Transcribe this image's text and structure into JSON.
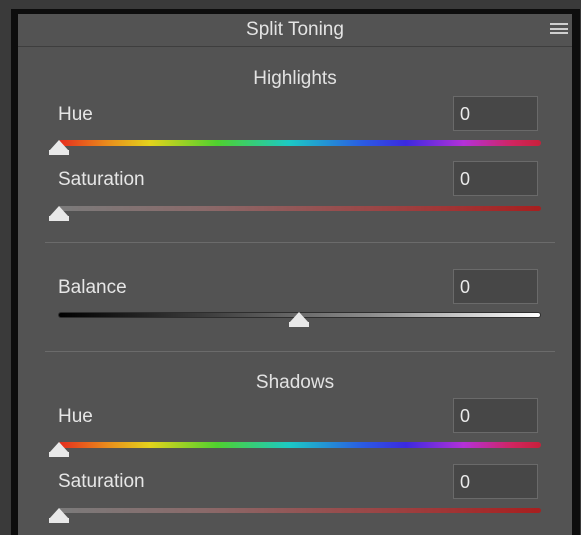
{
  "panel": {
    "title": "Split Toning",
    "menu_icon": "hamburger-menu-icon"
  },
  "highlights": {
    "heading": "Highlights",
    "hue": {
      "label": "Hue",
      "value": "0",
      "slider_fraction": 0.0
    },
    "saturation": {
      "label": "Saturation",
      "value": "0",
      "slider_fraction": 0.0
    }
  },
  "balance": {
    "label": "Balance",
    "value": "0",
    "slider_fraction": 0.5
  },
  "shadows": {
    "heading": "Shadows",
    "hue": {
      "label": "Hue",
      "value": "0",
      "slider_fraction": 0.0
    },
    "saturation": {
      "label": "Saturation",
      "value": "0",
      "slider_fraction": 0.0
    }
  }
}
